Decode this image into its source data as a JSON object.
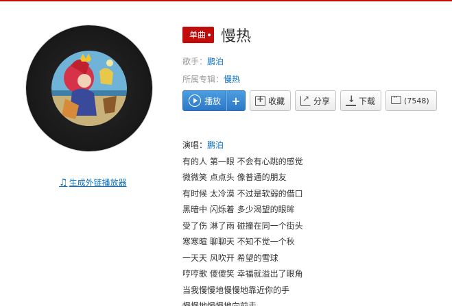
{
  "song": {
    "badge": "单曲",
    "title": "慢热"
  },
  "meta": {
    "singer_label": "歌手：",
    "singer": "鹏泊",
    "album_label": "所属专辑：",
    "album": "慢热"
  },
  "actions": {
    "play": "播放",
    "add": "+",
    "favorite": "收藏",
    "share": "分享",
    "download": "下载",
    "comments": "(7548)"
  },
  "external_player": "生成外链播放器",
  "lyrics": {
    "singer_label": "演唱：",
    "singer": "鹏泊",
    "lines": [
      "有的人 第一眼 不会有心跳的感觉",
      "微微笑 点点头 像普通的朋友",
      "有时候 太冷漠 不过是软弱的借口",
      "黑暗中 闪烁着 多少渴望的眼眸",
      "受了伤 淋了雨 碰撞在同一个街头",
      "寒寒暄 聊聊天 不知不觉一个秋",
      "一天天 风吹开 希望的雪球",
      "哼哼歌 傻傻笑 幸福就溢出了眼角",
      "当我慢慢地慢慢地靠近你的手",
      "慢慢地慢慢地向前走"
    ]
  },
  "colors": {
    "accent_red": "#c20c0c",
    "link_blue": "#0c73c2",
    "play_blue": "#2c78c8"
  },
  "icons": [
    "music-note-icon",
    "play-icon",
    "plus-icon",
    "favorite-icon",
    "share-icon",
    "download-icon",
    "comment-icon"
  ]
}
